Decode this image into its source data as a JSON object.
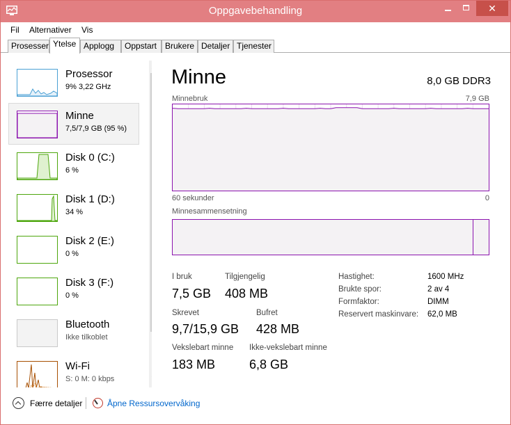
{
  "window": {
    "title": "Oppgavebehandling",
    "accent": "#e27f82",
    "close_color": "#c7504a"
  },
  "menu": {
    "items": [
      "Fil",
      "Alternativer",
      "Vis"
    ]
  },
  "tabs": [
    {
      "label": "Prosesser",
      "active": false
    },
    {
      "label": "Ytelse",
      "active": true
    },
    {
      "label": "Applogg",
      "active": false
    },
    {
      "label": "Oppstart",
      "active": false
    },
    {
      "label": "Brukere",
      "active": false
    },
    {
      "label": "Detaljer",
      "active": false
    },
    {
      "label": "Tjenester",
      "active": false
    }
  ],
  "sidebar": {
    "items": [
      {
        "name": "Prosessor",
        "sub": "9% 3,22 GHz",
        "color": "#4aa0d4"
      },
      {
        "name": "Minne",
        "sub": "7,5/7,9 GB (95 %)",
        "color": "#8b12ae"
      },
      {
        "name": "Disk 0 (C:)",
        "sub": "6 %",
        "color": "#4da60c"
      },
      {
        "name": "Disk 1 (D:)",
        "sub": "34 %",
        "color": "#4da60c"
      },
      {
        "name": "Disk 2 (E:)",
        "sub": "0 %",
        "color": "#4da60c"
      },
      {
        "name": "Disk 3 (F:)",
        "sub": "0 %",
        "color": "#4da60c"
      },
      {
        "name": "Bluetooth",
        "sub": "Ikke tilkoblet",
        "color": "#c9c9c9"
      },
      {
        "name": "Wi-Fi",
        "sub": "S: 0 M: 0 kbps",
        "color": "#a74f01"
      }
    ]
  },
  "main": {
    "title": "Minne",
    "spec": "8,0 GB DDR3",
    "usage_label": "Minnebruk",
    "usage_max": "7,9 GB",
    "time_left": "60 sekunder",
    "time_right": "0",
    "composition_label": "Minnesammensetning",
    "graph_color": "#8b12ae",
    "usage_level": 0.95,
    "stats": {
      "in_use_label": "I bruk",
      "in_use": "7,5 GB",
      "available_label": "Tilgjengelig",
      "available": "408 MB",
      "committed_label": "Skrevet",
      "committed": "9,7/15,9 GB",
      "cached_label": "Bufret",
      "cached": "428 MB",
      "paged_label": "Vekslebart minne",
      "paged": "183 MB",
      "nonpaged_label": "Ikke-vekslebart minne",
      "nonpaged": "6,8 GB"
    },
    "props": [
      {
        "label": "Hastighet:",
        "value": "1600 MHz"
      },
      {
        "label": "Brukte spor:",
        "value": "2 av 4"
      },
      {
        "label": "Formfaktor:",
        "value": "DIMM"
      },
      {
        "label": "Reservert maskinvare:",
        "value": "62,0 MB"
      }
    ]
  },
  "footer": {
    "fewer_details": "Færre detaljer",
    "open_monitor": "Åpne Ressursovervåking"
  }
}
